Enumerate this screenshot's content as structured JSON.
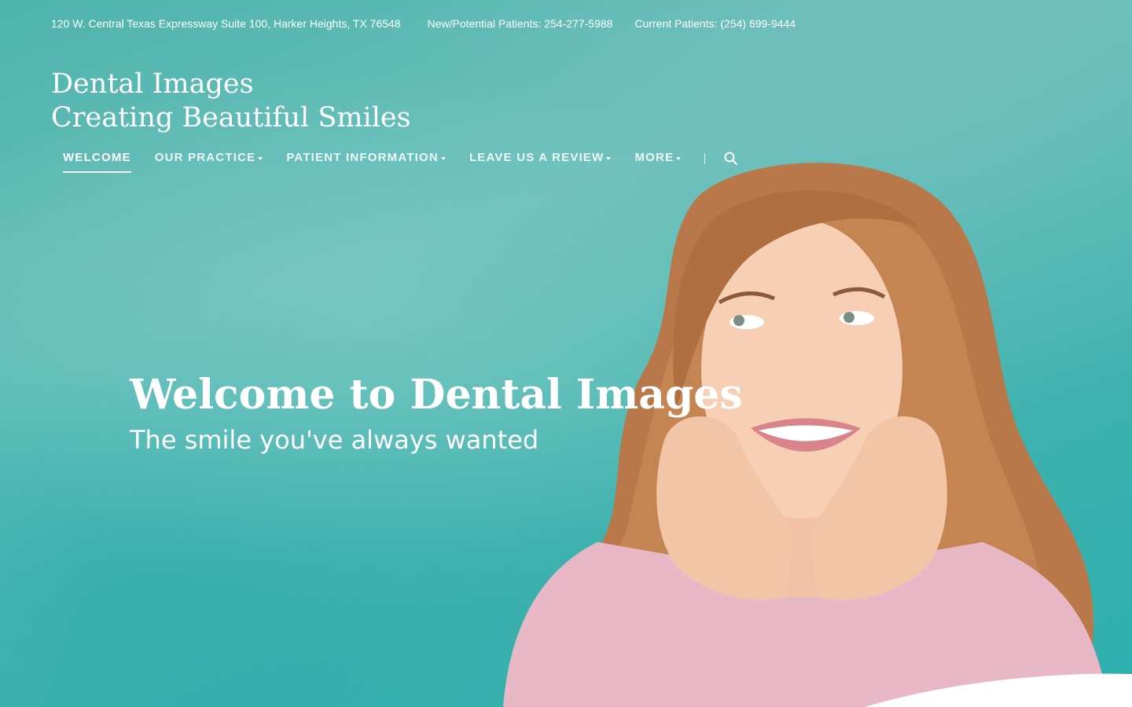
{
  "topbar": {
    "address": "120 W. Central Texas Expressway Suite 100, Harker Heights, TX 76548",
    "new_patients": "New/Potential Patients: 254-277-5988",
    "current_patients": "Current Patients: (254) 699-9444"
  },
  "brand": {
    "line1": "Dental Images",
    "line2": "Creating Beautiful Smiles"
  },
  "nav": {
    "items": [
      {
        "label": "WELCOME",
        "active": true
      },
      {
        "label": "OUR PRACTICE",
        "dropdown": true
      },
      {
        "label": "PATIENT INFORMATION",
        "dropdown": true
      },
      {
        "label": "LEAVE US A REVIEW",
        "dropdown": true
      },
      {
        "label": "MORE",
        "dropdown": true
      }
    ]
  },
  "hero": {
    "title": "Welcome to Dental Images",
    "subtitle": "The smile you've always wanted"
  },
  "colors": {
    "teal_background": "#4fb3ad",
    "text": "#ffffff"
  }
}
